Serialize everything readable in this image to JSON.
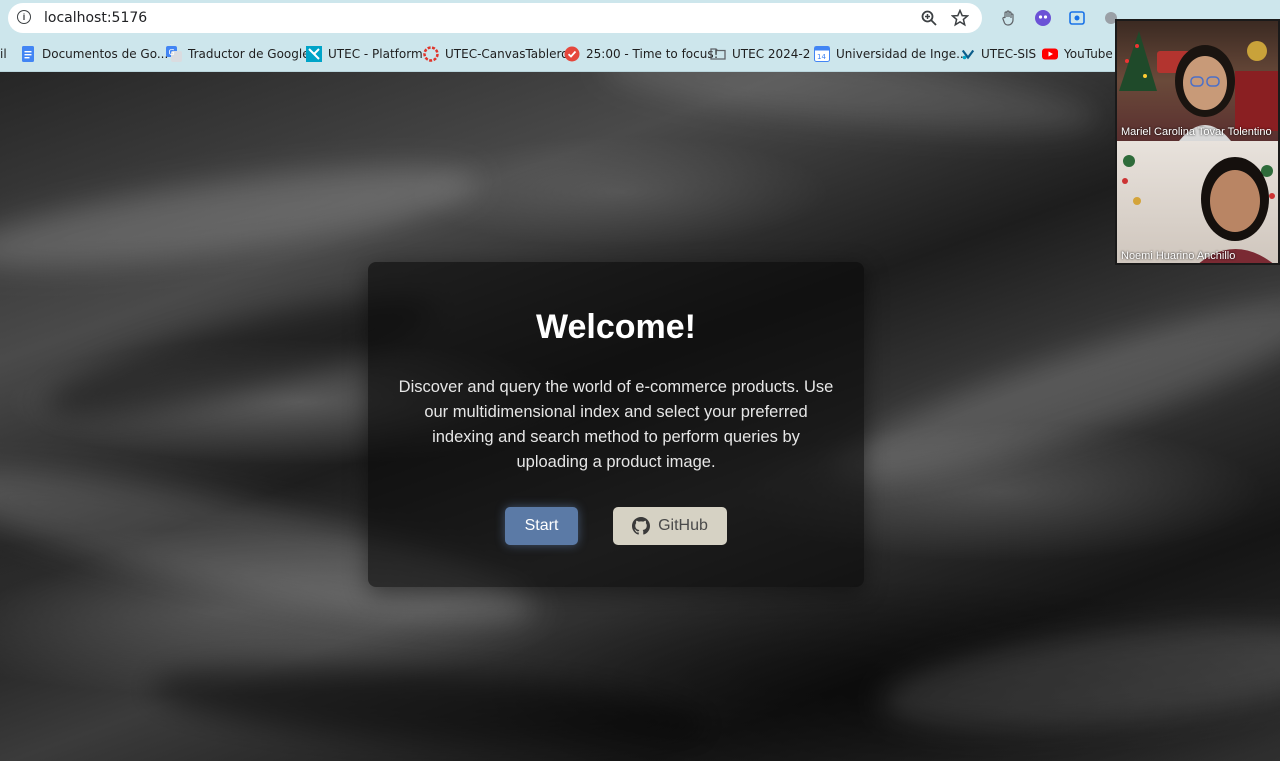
{
  "browser": {
    "url": "localhost:5176",
    "bookmarks": [
      {
        "label": "il",
        "icon": "bookmark-fragment-icon"
      },
      {
        "label": "Documentos de Go...",
        "icon": "google-docs-icon"
      },
      {
        "label": "Traductor de Google",
        "icon": "google-translate-icon"
      },
      {
        "label": "UTEC - Platform",
        "icon": "utec-icon"
      },
      {
        "label": "UTEC-CanvasTablero",
        "icon": "canvas-icon"
      },
      {
        "label": "25:00 - Time to focus!",
        "icon": "pomodoro-icon"
      },
      {
        "label": "UTEC 2024-2",
        "icon": "folder-icon"
      },
      {
        "label": "Universidad de Inge...",
        "icon": "calendar-icon"
      },
      {
        "label": "UTEC-SIS",
        "icon": "utec-sis-icon"
      },
      {
        "label": "YouTube",
        "icon": "youtube-icon"
      }
    ]
  },
  "hero": {
    "title": "Welcome!",
    "description": "Discover and query the world of e-commerce products. Use our multidimensional index and select your preferred indexing and search method to perform queries by uploading a product image.",
    "start_label": "Start",
    "github_label": "GitHub"
  },
  "call": {
    "participants": [
      {
        "name": "Mariel Carolina Tovar Tolentino"
      },
      {
        "name": "Noemi Huarino Anchillo"
      }
    ]
  },
  "colors": {
    "chrome": "#cde6ec",
    "start_button": "#5b7aa6",
    "github_button": "#d6d2c4"
  }
}
